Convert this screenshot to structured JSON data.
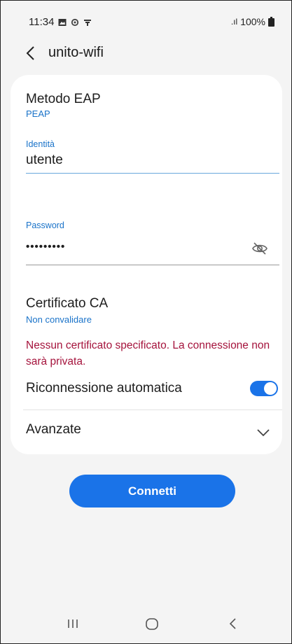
{
  "status": {
    "time": "11:34",
    "signal": ".ıl",
    "battery": "100%"
  },
  "header": {
    "title": "unito-wifi"
  },
  "form": {
    "eap_title": "Metodo EAP",
    "eap_value": "PEAP",
    "identity_label": "Identità",
    "identity_value": "utente",
    "password_label": "Password",
    "password_value": "•••••••••",
    "cert_title": "Certificato CA",
    "cert_value": "Non convalidare",
    "warning": "Nessun certificato specificato. La connessione non sarà privata.",
    "auto_reconnect_label": "Riconnessione automatica",
    "auto_reconnect_on": true,
    "advanced_label": "Avanzate"
  },
  "actions": {
    "connect_label": "Connetti"
  },
  "colors": {
    "accent": "#1a73e8",
    "link": "#1a73c9",
    "warning": "#a5133c",
    "card": "#ffffff",
    "background": "#f4f4f4"
  },
  "icons": {
    "back": "chevron-left-icon",
    "eye": "eye-off-icon",
    "expand": "chevron-down-icon",
    "nav_recent": "recent-apps-icon",
    "nav_home": "home-icon",
    "nav_back": "back-icon"
  }
}
